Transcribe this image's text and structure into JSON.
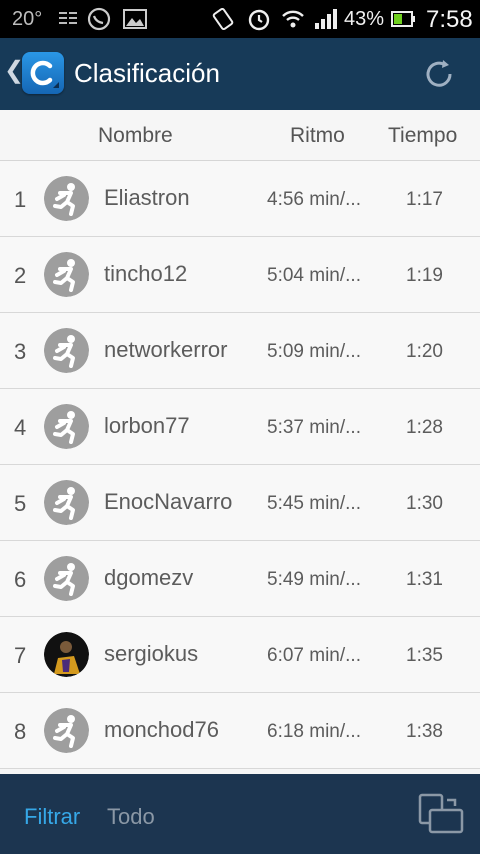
{
  "status_bar": {
    "temperature": "20°",
    "battery_percent": "43%",
    "time": "7:58",
    "icons": [
      "notification-icon",
      "whatsapp-icon",
      "image-icon",
      "rotate-icon",
      "alarm-icon",
      "wifi-icon",
      "signal-icon",
      "battery-icon"
    ]
  },
  "action_bar": {
    "title": "Clasificación",
    "icons": [
      "back-icon",
      "app-logo-icon",
      "refresh-icon"
    ]
  },
  "table": {
    "headers": {
      "name": "Nombre",
      "pace": "Ritmo",
      "time": "Tiempo"
    },
    "rows": [
      {
        "rank": "1",
        "name": "Eliastron",
        "pace": "4:56 min/...",
        "time": "1:17",
        "avatar": "default-runner-icon"
      },
      {
        "rank": "2",
        "name": "tincho12",
        "pace": "5:04 min/...",
        "time": "1:19",
        "avatar": "default-runner-icon"
      },
      {
        "rank": "3",
        "name": "networkerror",
        "pace": "5:09 min/...",
        "time": "1:20",
        "avatar": "default-runner-icon"
      },
      {
        "rank": "4",
        "name": "lorbon77",
        "pace": "5:37 min/...",
        "time": "1:28",
        "avatar": "default-runner-icon"
      },
      {
        "rank": "5",
        "name": "EnocNavarro",
        "pace": "5:45 min/...",
        "time": "1:30",
        "avatar": "default-runner-icon"
      },
      {
        "rank": "6",
        "name": "dgomezv",
        "pace": "5:49 min/...",
        "time": "1:31",
        "avatar": "default-runner-icon"
      },
      {
        "rank": "7",
        "name": "sergiokus",
        "pace": "6:07 min/...",
        "time": "1:35",
        "avatar": "photo-avatar"
      },
      {
        "rank": "8",
        "name": "monchod76",
        "pace": "6:18 min/...",
        "time": "1:38",
        "avatar": "default-runner-icon"
      }
    ]
  },
  "bottom_bar": {
    "filter_label": "Filtrar",
    "all_label": "Todo",
    "switch_icon": "switch-view-icon"
  },
  "colors": {
    "action_bar": "#173a58",
    "bottom_bar": "#1c3550",
    "accent": "#36a8e8",
    "avatar_gray": "#9e9e9e"
  }
}
